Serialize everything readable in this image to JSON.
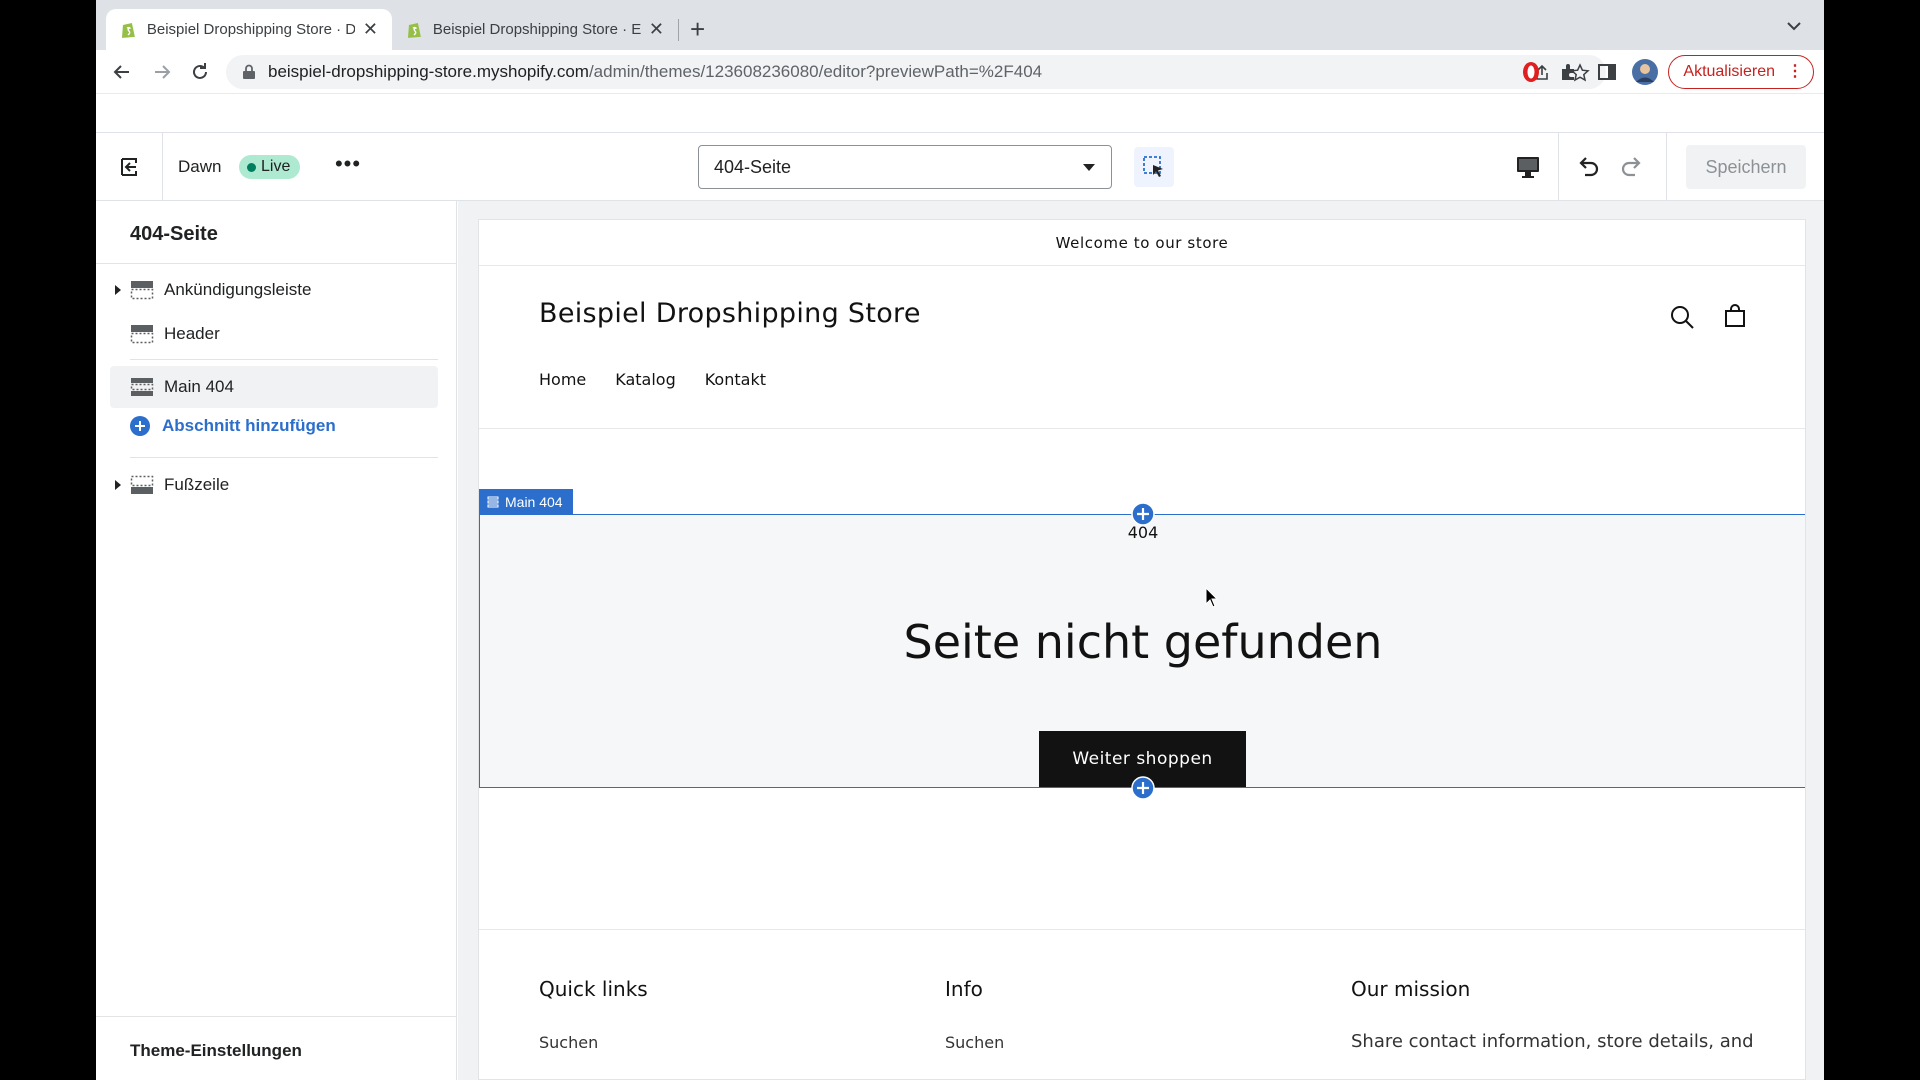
{
  "browser": {
    "tabs": [
      {
        "title": "Beispiel Dropshipping Store · D",
        "active": true
      },
      {
        "title": "Beispiel Dropshipping Store · E",
        "active": false
      }
    ],
    "url_host": "beispiel-dropshipping-store.myshopify.com",
    "url_path": "/admin/themes/123608236080/editor?previewPath=%2F404",
    "update_label": "Aktualisieren"
  },
  "editor": {
    "theme_name": "Dawn",
    "live_label": "Live",
    "page_select_value": "404-Seite",
    "save_label": "Speichern"
  },
  "sidebar": {
    "title": "404-Seite",
    "items": [
      {
        "label": "Ankündigungsleiste"
      },
      {
        "label": "Header"
      },
      {
        "label": "Main 404"
      },
      {
        "label": "Fußzeile"
      }
    ],
    "add_section_label": "Abschnitt hinzufügen",
    "footer_label": "Theme-Einstellungen"
  },
  "store": {
    "announcement": "Welcome to our store",
    "name": "Beispiel Dropshipping Store",
    "nav": [
      "Home",
      "Katalog",
      "Kontakt"
    ],
    "section_tag": "Main 404",
    "code": "404",
    "not_found_title": "Seite nicht gefunden",
    "continue_button": "Weiter shoppen",
    "footer": {
      "quick_links_heading": "Quick links",
      "quick_links_item": "Suchen",
      "info_heading": "Info",
      "info_item": "Suchen",
      "mission_heading": "Our mission",
      "mission_text": "Share contact information, store details, and"
    }
  },
  "colors": {
    "accent": "#2c6ecb",
    "live_badge": "#aee9d1",
    "update_red": "#c5221f",
    "button_dark": "#121212"
  }
}
